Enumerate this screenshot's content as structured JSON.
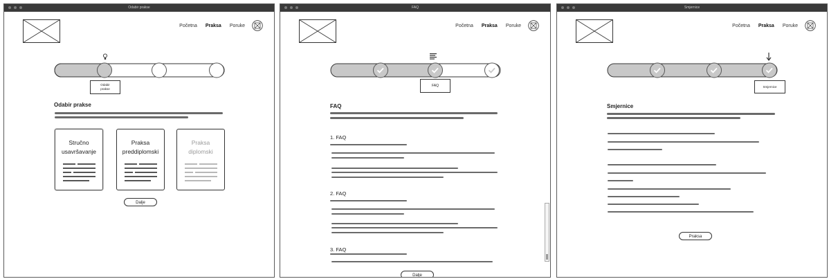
{
  "windows": [
    {
      "title": "Odabir prakse"
    },
    {
      "title": "FAQ"
    },
    {
      "title": "Smjernice"
    }
  ],
  "nav": {
    "home": "Početna",
    "internship": "Praksa",
    "messages": "Poruke"
  },
  "screen1": {
    "step_label_line1": "Odabir",
    "step_label_line2": "prakse",
    "heading": "Odabir prakse",
    "cards": [
      {
        "line1": "Stručno",
        "line2": "usavršavanje"
      },
      {
        "line1": "Praksa",
        "line2": "preddiplomski"
      },
      {
        "line1": "Praksa",
        "line2": "diplomski"
      }
    ],
    "button": "Dalje"
  },
  "screen2": {
    "step_label": "FAQ",
    "heading": "FAQ",
    "sections": [
      "1. FAQ",
      "2. FAQ",
      "3. FAQ"
    ],
    "button": "Dalje"
  },
  "screen3": {
    "step_label": "Smjernice",
    "heading": "Smjernice",
    "button": "Praksa"
  },
  "colors": {
    "progress_fill": "#c8c8c8",
    "text_line": "#6a6a6a"
  }
}
